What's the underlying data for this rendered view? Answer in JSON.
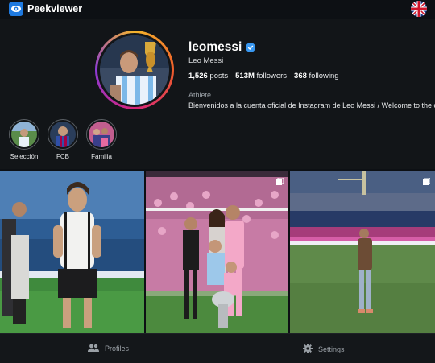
{
  "app": {
    "name": "Peekviewer",
    "language_flag": "uk-flag"
  },
  "profile": {
    "username": "leomessi",
    "verified": true,
    "full_name": "Leo Messi",
    "stats": [
      {
        "value": "1,526",
        "label": "posts"
      },
      {
        "value": "513M",
        "label": "followers"
      },
      {
        "value": "368",
        "label": "following"
      }
    ],
    "category": "Athlete",
    "bio": "Bienvenidos a la cuenta oficial de Instagram de Leo Messi / Welcome to the off"
  },
  "highlights": [
    {
      "label": "Selección"
    },
    {
      "label": "FCB"
    },
    {
      "label": "Familia"
    }
  ],
  "posts": [
    {
      "type": "single",
      "scene": "training-ground-photo"
    },
    {
      "type": "carousel",
      "scene": "family-trophy-photo"
    },
    {
      "type": "carousel",
      "scene": "stadium-pitch-photo"
    }
  ],
  "nav": {
    "profiles_label": "Profiles",
    "settings_label": "Settings",
    "profiles_icon": "users-icon",
    "settings_icon": "gear-icon"
  },
  "colors": {
    "background": "#0d1014",
    "accent": "#1f7ae0",
    "verified": "#3897f0",
    "ring_gradient": [
      "#f5b52c",
      "#ef5d2a",
      "#d6247a",
      "#8c3ad6"
    ]
  }
}
